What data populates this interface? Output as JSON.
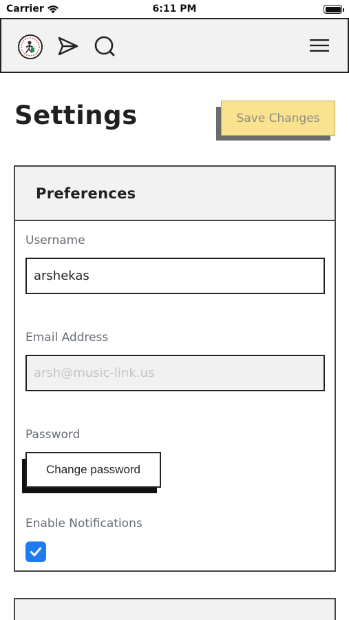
{
  "status_bar": {
    "carrier": "Carrier",
    "time": "6:11 PM"
  },
  "navbar": {
    "logo": "profile-logo",
    "icons": [
      "send-icon",
      "search-icon",
      "menu-icon"
    ]
  },
  "page": {
    "title": "Settings",
    "save_label": "Save Changes"
  },
  "preferences": {
    "header": "Preferences",
    "username_label": "Username",
    "username_value": "arshekas",
    "email_label": "Email Address",
    "email_value": "arsh@music-link.us",
    "password_label": "Password",
    "change_password_label": "Change password",
    "notifications_label": "Enable Notifications",
    "notifications_enabled": true
  },
  "colors": {
    "save_button": "#fae38f",
    "checkbox": "#1e7cf3",
    "navbar_bg": "#f2f2f2"
  }
}
